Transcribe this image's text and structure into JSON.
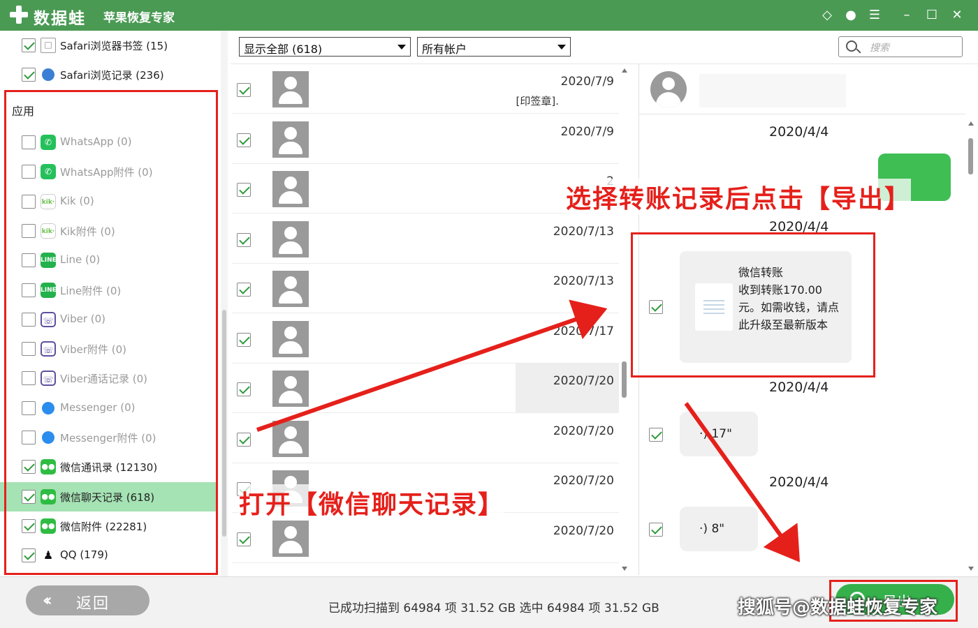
{
  "titlebar": {
    "app_name": "数据蛙",
    "app_subtitle": "苹果恢复专家",
    "icons": [
      "diamond-icon",
      "chat-icon",
      "list-icon",
      "minimize-icon",
      "maximize-icon",
      "close-icon"
    ]
  },
  "sidebar": {
    "top_items": [
      {
        "label": "Safari浏览器书签 (15)",
        "checked": true,
        "icon": "bookmark-icon"
      },
      {
        "label": "Safari浏览记录 (236)",
        "checked": true,
        "icon": "safari-icon"
      }
    ],
    "section_title": "应用",
    "items": [
      {
        "label": "WhatsApp (0)",
        "checked": false,
        "icon": "whatsapp-icon",
        "glyph": "✆"
      },
      {
        "label": "WhatsApp附件 (0)",
        "checked": false,
        "icon": "whatsapp-icon",
        "glyph": "✆"
      },
      {
        "label": "Kik (0)",
        "checked": false,
        "icon": "kik-icon",
        "glyph": "kik·"
      },
      {
        "label": "Kik附件 (0)",
        "checked": false,
        "icon": "kik-icon",
        "glyph": "kik·"
      },
      {
        "label": "Line (0)",
        "checked": false,
        "icon": "line-icon",
        "glyph": "LINE"
      },
      {
        "label": "Line附件 (0)",
        "checked": false,
        "icon": "line-icon",
        "glyph": "LINE"
      },
      {
        "label": "Viber (0)",
        "checked": false,
        "icon": "viber-icon",
        "glyph": "☏"
      },
      {
        "label": "Viber附件 (0)",
        "checked": false,
        "icon": "viber-icon",
        "glyph": "☏"
      },
      {
        "label": "Viber通话记录 (0)",
        "checked": false,
        "icon": "viber-icon",
        "glyph": "☏"
      },
      {
        "label": "Messenger (0)",
        "checked": false,
        "icon": "messenger-icon",
        "glyph": ""
      },
      {
        "label": "Messenger附件 (0)",
        "checked": false,
        "icon": "messenger-icon",
        "glyph": ""
      },
      {
        "label": "微信通讯录 (12130)",
        "checked": true,
        "icon": "wechat-icon",
        "glyph": "●●"
      },
      {
        "label": "微信聊天记录 (618)",
        "checked": true,
        "icon": "wechat-icon",
        "glyph": "●●",
        "selected": true
      },
      {
        "label": "微信附件 (22281)",
        "checked": true,
        "icon": "wechat-icon",
        "glyph": "●●"
      },
      {
        "label": "QQ (179)",
        "checked": true,
        "icon": "qq-icon",
        "glyph": "♟"
      }
    ]
  },
  "toolbar": {
    "filter_value": "显示全部 (618)",
    "account_value": "所有帐户",
    "search_placeholder": "搜索"
  },
  "messages": [
    {
      "date": "2020/7/9",
      "snippet": "[印签章]."
    },
    {
      "date": "2020/7/9",
      "snippet": ""
    },
    {
      "date": "2",
      "snippet": ""
    },
    {
      "date": "2020/7/13",
      "snippet": ""
    },
    {
      "date": "2020/7/13",
      "snippet": ""
    },
    {
      "date": "2020/7/17",
      "snippet": ""
    },
    {
      "date": "2020/7/20",
      "snippet": "",
      "highlighted": true
    },
    {
      "date": "2020/7/20",
      "snippet": ""
    },
    {
      "date": "2020/7/20",
      "snippet": ""
    },
    {
      "date": "2020/7/20",
      "snippet": ""
    }
  ],
  "chat": {
    "dates": [
      "2020/4/4",
      "2020/4/4",
      "2020/4/4",
      "2020/4/4"
    ],
    "transfer_text": "微信转账\n收到转账170.00元。如需收钱，请点此升级至最新版本",
    "voice_messages": [
      "·)  17\"",
      "·)  8\""
    ]
  },
  "bottom": {
    "back_label": "返回",
    "status": "已成功扫描到 64984 项 31.52 GB  选中 64984 项 31.52 GB",
    "export_label": "导出"
  },
  "annotations": {
    "top_right": "选择转账记录后点击【导出】",
    "middle": "打开【微信聊天记录】",
    "watermark": "搜狐号@数据蛙恢复专家"
  },
  "colors": {
    "titlebar": "#4b9a54",
    "selected_row": "#a5e2b4",
    "annotation_red": "#e5201b",
    "export_button": "#35b04b"
  }
}
